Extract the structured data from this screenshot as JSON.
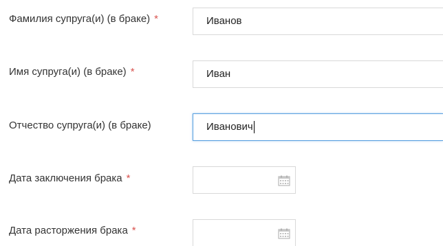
{
  "form": {
    "required_mark": "*",
    "fields": [
      {
        "label": "Фамилия супруга(и) (в браке)",
        "required": true,
        "value": "Иванов"
      },
      {
        "label": "Имя супруга(и) (в браке)",
        "required": true,
        "value": "Иван"
      },
      {
        "label": "Отчество супруга(и) (в браке)",
        "required": false,
        "value": "Иванович",
        "focused": true
      },
      {
        "label": "Дата заключения брака",
        "required": true,
        "value": ""
      },
      {
        "label": "Дата расторжения брака",
        "required": true,
        "value": ""
      }
    ],
    "date_icon": "calendar-icon",
    "colors": {
      "required": "#d9534f",
      "focus_border": "#5aa0e0",
      "label": "#333333",
      "border": "#d8d8d8"
    }
  }
}
